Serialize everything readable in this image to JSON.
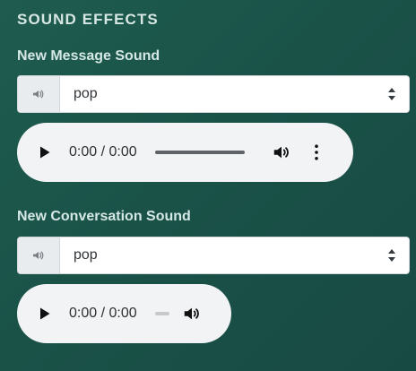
{
  "section": {
    "title": "SOUND EFFECTS"
  },
  "new_message": {
    "label": "New Message Sound",
    "select": {
      "value": "pop",
      "icon": "volume-icon"
    },
    "player": {
      "time": "0:00 / 0:00",
      "controls": [
        "play-icon",
        "seek-track",
        "volume-icon",
        "more-options-icon"
      ]
    }
  },
  "new_conversation": {
    "label": "New Conversation Sound",
    "select": {
      "value": "pop",
      "icon": "volume-icon"
    },
    "player": {
      "time": "0:00 / 0:00",
      "controls": [
        "play-icon",
        "seek-track",
        "volume-icon"
      ]
    }
  },
  "colors": {
    "background_start": "#1f5c4f",
    "background_end": "#174a43",
    "player_bg": "#f1f3f4",
    "select_bg": "#ffffff"
  }
}
